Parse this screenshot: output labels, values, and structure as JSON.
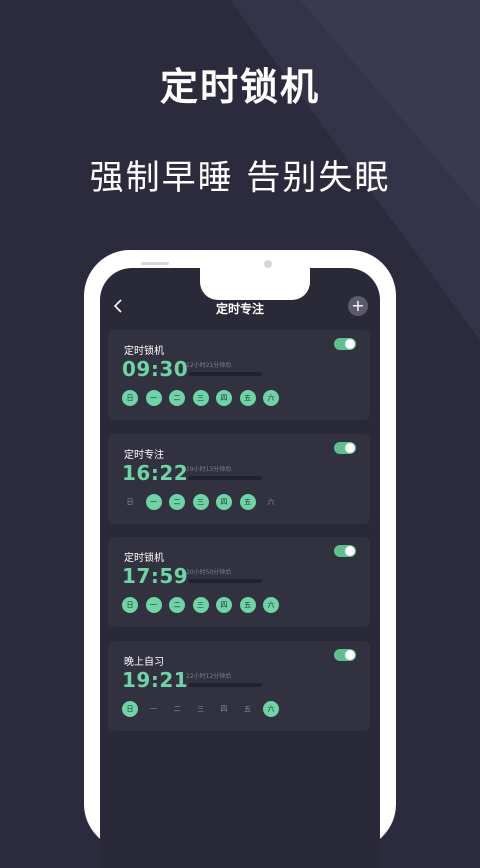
{
  "promo": {
    "title": "定时锁机",
    "subtitle": "强制早睡  告别失眠"
  },
  "app": {
    "header_title": "定时专注",
    "add_label": "+",
    "back_icon": "chevron-left-icon"
  },
  "colors": {
    "background": "#2c2b3d",
    "accent": "#6fd3a5",
    "card": "#32313f"
  },
  "cards": [
    {
      "name": "定时锁机",
      "time": "09:30",
      "remaining": "12小时21分钟后",
      "enabled": true,
      "days": [
        {
          "label": "日",
          "on": true
        },
        {
          "label": "一",
          "on": true
        },
        {
          "label": "二",
          "on": true
        },
        {
          "label": "三",
          "on": true
        },
        {
          "label": "四",
          "on": true
        },
        {
          "label": "五",
          "on": true
        },
        {
          "label": "六",
          "on": true
        }
      ]
    },
    {
      "name": "定时专注",
      "time": "16:22",
      "remaining": "19小时13分钟后",
      "enabled": true,
      "days": [
        {
          "label": "日",
          "on": false
        },
        {
          "label": "一",
          "on": true
        },
        {
          "label": "二",
          "on": true
        },
        {
          "label": "三",
          "on": true
        },
        {
          "label": "四",
          "on": true
        },
        {
          "label": "五",
          "on": true
        },
        {
          "label": "六",
          "on": false
        }
      ]
    },
    {
      "name": "定时锁机",
      "time": "17:59",
      "remaining": "20小时50分钟后",
      "enabled": true,
      "days": [
        {
          "label": "日",
          "on": true
        },
        {
          "label": "一",
          "on": true
        },
        {
          "label": "二",
          "on": true
        },
        {
          "label": "三",
          "on": true
        },
        {
          "label": "四",
          "on": true
        },
        {
          "label": "五",
          "on": true
        },
        {
          "label": "六",
          "on": true
        }
      ]
    },
    {
      "name": "晚上自习",
      "time": "19:21",
      "remaining": "22小时12分钟后",
      "enabled": true,
      "days": [
        {
          "label": "日",
          "on": true
        },
        {
          "label": "一",
          "on": false
        },
        {
          "label": "二",
          "on": false
        },
        {
          "label": "三",
          "on": false
        },
        {
          "label": "四",
          "on": false
        },
        {
          "label": "五",
          "on": false
        },
        {
          "label": "六",
          "on": true
        }
      ]
    }
  ]
}
